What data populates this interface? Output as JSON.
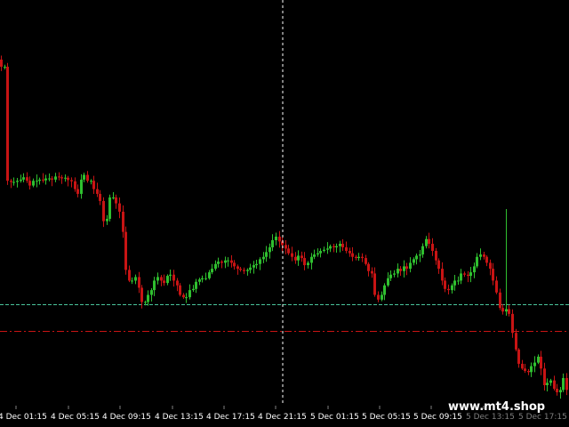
{
  "app": {
    "watermark": "www.mt4.shop"
  },
  "colors": {
    "background": "#000000",
    "bull": "#2fbf2f",
    "bear": "#c81414",
    "support_line": "#49c49b",
    "resistance_line": "#c81414",
    "crosshair": "#ffffff",
    "axis_text": "#ffffff"
  },
  "chart_data": {
    "type": "candlestick",
    "title": "",
    "time_axis_labels": [
      "4 Dec 01:15",
      "4 Dec 05:15",
      "4 Dec 09:15",
      "4 Dec 13:15",
      "4 Dec 17:15",
      "4 Dec 21:15",
      "5 Dec 01:15",
      "5 Dec 05:15",
      "5 Dec 09:15",
      "5 Dec 13:15",
      "5 Dec 17:15"
    ],
    "price_series": [
      100,
      100,
      52,
      51.5,
      51.5,
      52,
      52.5,
      53.5,
      52,
      50,
      52,
      52,
      52.5,
      52.2,
      53,
      53,
      52.5,
      53.8,
      53.5,
      53,
      53.3,
      52.3,
      51.8,
      48.5,
      46.5,
      52.5,
      54.5,
      52,
      52,
      48.5,
      46.5,
      43.5,
      35,
      36,
      45,
      45,
      42.5,
      39,
      30.5,
      14.5,
      10,
      10,
      11.5,
      7,
      1,
      1,
      4,
      6,
      10,
      11.5,
      10,
      9,
      12,
      12.5,
      10,
      8,
      4,
      3,
      3,
      6,
      6.5,
      9.5,
      10.5,
      11,
      11,
      13.5,
      15,
      17,
      18,
      17.5,
      18.5,
      18.5,
      17.5,
      16,
      15,
      14.5,
      14,
      14.5,
      15.5,
      16.5,
      17,
      19,
      20,
      22,
      24,
      27,
      28.5,
      26.5,
      25,
      23.5,
      21.5,
      20,
      18.5,
      20.5,
      19.5,
      16.5,
      17.5,
      20,
      21,
      21.5,
      22.5,
      23,
      23.5,
      24.5,
      24,
      24.5,
      25.5,
      24,
      22.5,
      21.5,
      20,
      19.5,
      20,
      19.5,
      17,
      14,
      13,
      4,
      2,
      4,
      8,
      11,
      12.5,
      13,
      15,
      14,
      16,
      15,
      17.5,
      19,
      20.5,
      21,
      24.5,
      27.5,
      25.5,
      22.5,
      18.5,
      15,
      10,
      6.5,
      6,
      8,
      10,
      10,
      13,
      12.5,
      12,
      13.5,
      16,
      20,
      21,
      20,
      17.5,
      15,
      10,
      5,
      -1.5,
      -3,
      -2,
      -4,
      -12,
      -19,
      -25,
      -27,
      -28,
      -28.5,
      -26,
      -24.5,
      -22,
      -27,
      -34,
      -33,
      -32,
      -35.5,
      -37,
      -36,
      -31,
      -36
    ],
    "reference_lines": [
      {
        "kind": "dashed",
        "level": 0,
        "color": "#49c49b"
      },
      {
        "kind": "dash-dot",
        "level": -11,
        "color": "#c81414"
      }
    ],
    "crosshair_time": "4 Dec 21:15",
    "grid": false
  }
}
